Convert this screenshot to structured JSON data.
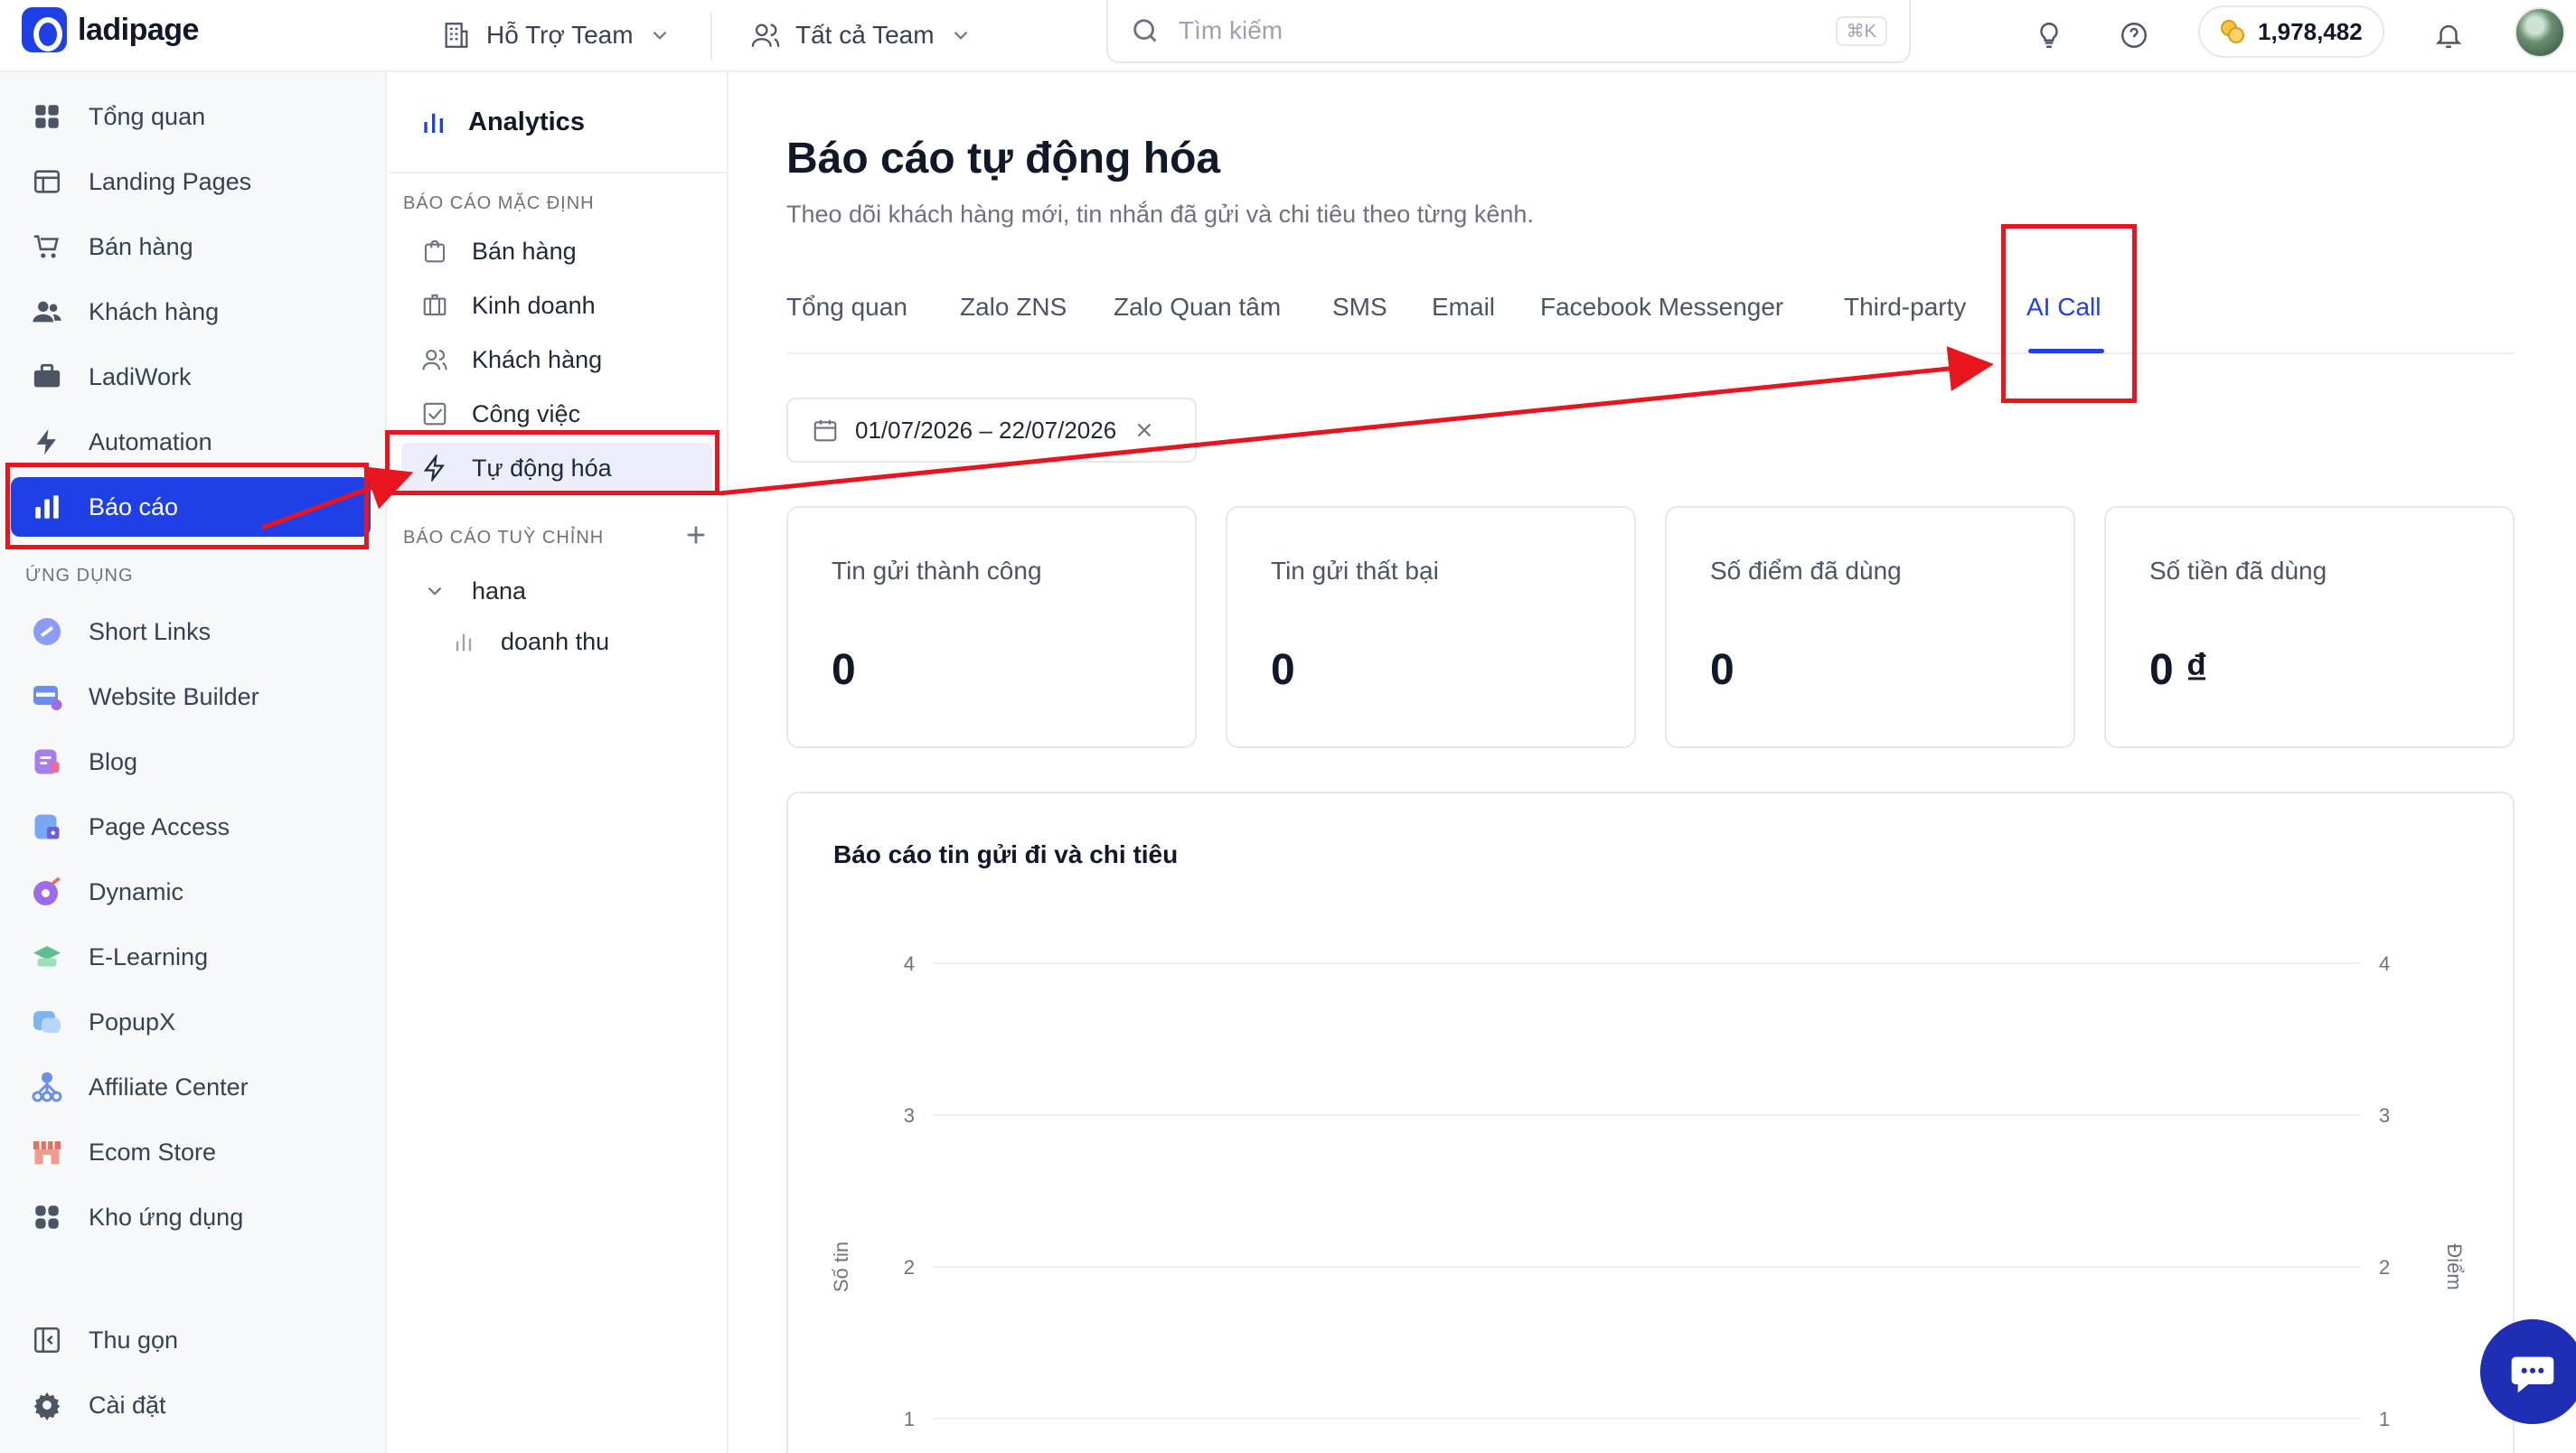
{
  "app": {
    "logo_text": "ladipage"
  },
  "topbar": {
    "team_label": "Hỗ Trợ Team",
    "all_team_label": "Tất cả Team",
    "search_placeholder": "Tìm kiếm",
    "search_shortcut": "⌘K",
    "credits": "1,978,482"
  },
  "sidebar": {
    "items": [
      {
        "label": "Tổng quan",
        "icon": "grid-icon"
      },
      {
        "label": "Landing Pages",
        "icon": "layout-icon"
      },
      {
        "label": "Bán hàng",
        "icon": "cart-icon"
      },
      {
        "label": "Khách hàng",
        "icon": "users-icon"
      },
      {
        "label": "LadiWork",
        "icon": "briefcase-icon"
      },
      {
        "label": "Automation",
        "icon": "bolt-icon"
      },
      {
        "label": "Báo cáo",
        "icon": "bar-chart-icon"
      }
    ],
    "apps_label": "ỨNG DỤNG",
    "apps": [
      {
        "label": "Short Links",
        "color": "#8b9cf4"
      },
      {
        "label": "Website Builder",
        "color": "#6b8cf0"
      },
      {
        "label": "Blog",
        "color": "#a77df2"
      },
      {
        "label": "Page Access",
        "color": "#7aa7f5"
      },
      {
        "label": "Dynamic",
        "color": "#9b6de8"
      },
      {
        "label": "E-Learning",
        "color": "#5fbf8f"
      },
      {
        "label": "PopupX",
        "color": "#7cb3f0"
      },
      {
        "label": "Affiliate Center",
        "color": "#6c8fe8"
      },
      {
        "label": "Ecom Store",
        "color": "#ef6b5b"
      },
      {
        "label": "Kho ứng dụng",
        "color": "#4b5563"
      }
    ],
    "collapse_label": "Thu gọn",
    "settings_label": "Cài đặt"
  },
  "subnav": {
    "title": "Analytics",
    "default_reports_label": "BÁO CÁO MẶC ĐỊNH",
    "default_reports": [
      "Bán hàng",
      "Kinh doanh",
      "Khách hàng",
      "Công việc",
      "Tự động hóa"
    ],
    "custom_reports_label": "BÁO CÁO TUỲ CHỈNH",
    "custom_group": "hana",
    "custom_item": "doanh thu"
  },
  "main": {
    "title": "Báo cáo tự động hóa",
    "subtitle": "Theo dõi khách hàng mới, tin nhắn đã gửi và chi tiêu theo từng kênh.",
    "tabs": [
      "Tổng quan",
      "Zalo ZNS",
      "Zalo Quan tâm",
      "SMS",
      "Email",
      "Facebook Messenger",
      "Third-party",
      "AI Call"
    ],
    "active_tab": "AI Call",
    "date_range": "01/07/2026 – 22/07/2026",
    "stats": [
      {
        "label": "Tin gửi thành công",
        "value": "0"
      },
      {
        "label": "Tin gửi thất bại",
        "value": "0"
      },
      {
        "label": "Số điểm đã dùng",
        "value": "0"
      },
      {
        "label": "Số tiền đã dùng",
        "value": "0 ₫"
      }
    ]
  },
  "chart_data": {
    "type": "line",
    "title": "Báo cáo tin gửi đi và chi tiêu",
    "ylabel": "Số tin",
    "y2label": "Điểm",
    "yticks": [
      1,
      2,
      3,
      4
    ],
    "y2ticks": [
      1,
      2,
      3,
      4
    ],
    "grid": true,
    "series": []
  },
  "colors": {
    "accent": "#1e40e6",
    "annotation": "#e8141e"
  }
}
